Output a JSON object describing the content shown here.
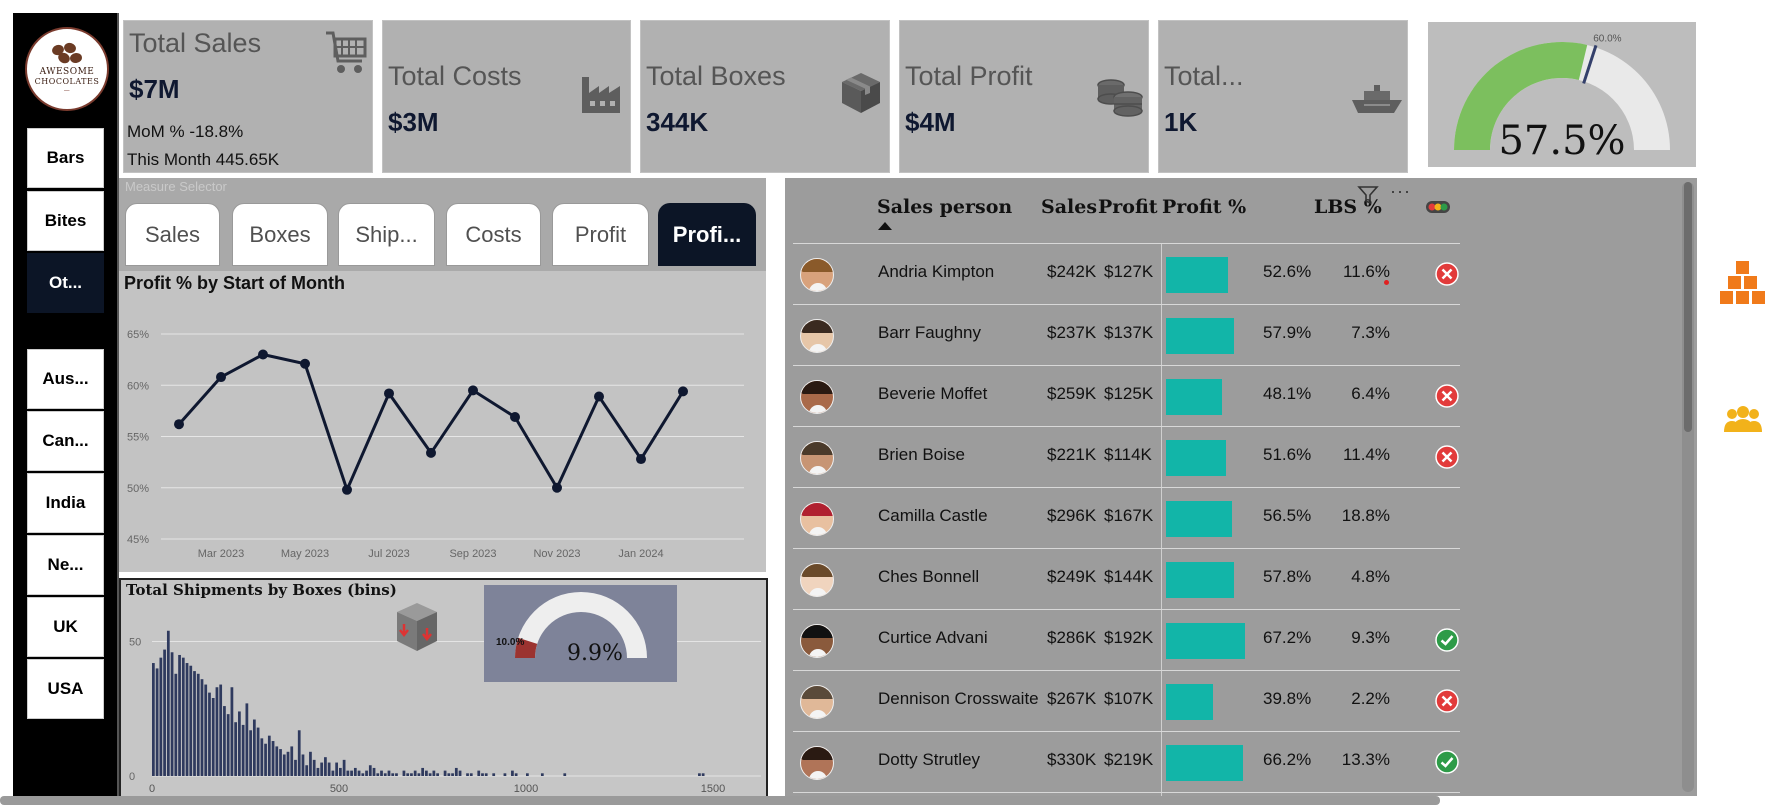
{
  "logo": {
    "line1": "AWESOME",
    "line2": "CHOCOLATES"
  },
  "slicer": {
    "categories": [
      "Bars",
      "Bites",
      "Ot..."
    ],
    "countries": [
      "Aus...",
      "Can...",
      "India",
      "Ne...",
      "UK",
      "USA"
    ]
  },
  "kpis": {
    "sales": {
      "title": "Total Sales",
      "value": "$7M",
      "mom": "MoM % -18.8%",
      "month": "This Month 445.65K",
      "icon": "shopping-cart-icon"
    },
    "costs": {
      "title": "Total Costs",
      "value": "$3M",
      "icon": "factory-icon"
    },
    "boxes": {
      "title": "Total Boxes",
      "value": "344K",
      "icon": "box-icon"
    },
    "profit": {
      "title": "Total Profit",
      "value": "$4M",
      "icon": "coins-icon"
    },
    "shipments": {
      "title": "Total...",
      "value": "1K",
      "icon": "ship-icon"
    }
  },
  "profit_gauge": {
    "value_label": "57.5%",
    "target_label": "60.0%",
    "value": 57.5,
    "target": 60,
    "colors": {
      "fill": "#7cbf5e",
      "track": "#e9e9e9",
      "target": "#34406b"
    }
  },
  "measure_selector": {
    "title": "Measure Selector",
    "options": [
      "Sales",
      "Boxes",
      "Ship...",
      "Costs",
      "Profit",
      "Profi..."
    ],
    "selected": "Profi..."
  },
  "line_chart": {
    "title": "Profit % by Start of Month",
    "y_ticks": [
      "65%",
      "60%",
      "55%",
      "50%",
      "45%"
    ],
    "x_ticks": [
      "Mar 2023",
      "May 2023",
      "Jul 2023",
      "Sep 2023",
      "Nov 2023",
      "Jan 2024"
    ]
  },
  "histogram": {
    "title": "Total Shipments by Boxes (bins)",
    "y_ticks": [
      "50",
      "0"
    ],
    "x_ticks": [
      "0",
      "500",
      "1000",
      "1500"
    ],
    "icon": "broken-box-icon"
  },
  "mini_gauge": {
    "value_label": "9.9%",
    "target_label": "10.0%",
    "value": 9.9,
    "target": 10,
    "colors": {
      "fill": "#9b3330",
      "track": "#eeeeee",
      "bg": "#7e8399"
    }
  },
  "table": {
    "headers": {
      "person": "Sales person",
      "sales": "Sales",
      "profit": "Profit",
      "profit_pct": "Profit %",
      "lbs_pct": "LBS %"
    },
    "rows": [
      {
        "name": "Andria Kimpton",
        "sales": "$242K",
        "profit": "$127K",
        "profit_pct": "52.6%",
        "pct_value": 52.6,
        "lbs": "11.6%",
        "status": "fail"
      },
      {
        "name": "Barr Faughny",
        "sales": "$237K",
        "profit": "$137K",
        "profit_pct": "57.9%",
        "pct_value": 57.9,
        "lbs": "7.3%",
        "status": "none"
      },
      {
        "name": "Beverie Moffet",
        "sales": "$259K",
        "profit": "$125K",
        "profit_pct": "48.1%",
        "pct_value": 48.1,
        "lbs": "6.4%",
        "status": "fail"
      },
      {
        "name": "Brien Boise",
        "sales": "$221K",
        "profit": "$114K",
        "profit_pct": "51.6%",
        "pct_value": 51.6,
        "lbs": "11.4%",
        "status": "fail"
      },
      {
        "name": "Camilla Castle",
        "sales": "$296K",
        "profit": "$167K",
        "profit_pct": "56.5%",
        "pct_value": 56.5,
        "lbs": "18.8%",
        "status": "none"
      },
      {
        "name": "Ches Bonnell",
        "sales": "$249K",
        "profit": "$144K",
        "profit_pct": "57.8%",
        "pct_value": 57.8,
        "lbs": "4.8%",
        "status": "none"
      },
      {
        "name": "Curtice Advani",
        "sales": "$286K",
        "profit": "$192K",
        "profit_pct": "67.2%",
        "pct_value": 67.2,
        "lbs": "9.3%",
        "status": "ok"
      },
      {
        "name": "Dennison Crosswaite",
        "sales": "$267K",
        "profit": "$107K",
        "profit_pct": "39.8%",
        "pct_value": 39.8,
        "lbs": "2.2%",
        "status": "fail"
      },
      {
        "name": "Dotty Strutley",
        "sales": "$330K",
        "profit": "$219K",
        "profit_pct": "66.2%",
        "pct_value": 66.2,
        "lbs": "13.3%",
        "status": "ok"
      }
    ]
  },
  "side_icons": [
    "boxes-stack-icon",
    "people-group-icon"
  ],
  "colors": {
    "accent_dark": "#0c1526",
    "teal_bar": "#12b5a8",
    "line": "#0f1830",
    "hist_bar": "#2f3a5e",
    "fail": "#e23b3b",
    "ok": "#2e9b48",
    "orange": "#f07a1a",
    "gold": "#f2b21a"
  },
  "chart_data": [
    {
      "type": "line",
      "title": "Profit % by Start of Month",
      "x": [
        "Feb 2023",
        "Mar 2023",
        "Apr 2023",
        "May 2023",
        "Jun 2023",
        "Jul 2023",
        "Aug 2023",
        "Sep 2023",
        "Oct 2023",
        "Nov 2023",
        "Dec 2023",
        "Jan 2024",
        "Feb 2024"
      ],
      "series": [
        {
          "values": [
            56.2,
            60.8,
            63.0,
            62.1,
            49.8,
            59.2,
            53.4,
            59.5,
            56.9,
            50.0,
            58.9,
            52.8,
            59.4
          ]
        }
      ],
      "ylim": [
        45,
        65
      ],
      "grid": true
    },
    {
      "type": "bar",
      "title": "Total Shipments by Boxes (bins)",
      "bin_width": 10,
      "x_start": 0,
      "values": [
        42,
        40,
        44,
        47,
        54,
        46,
        38,
        45,
        44,
        42,
        41,
        39,
        38,
        36,
        34,
        31,
        29,
        33,
        34,
        26,
        23,
        33,
        20,
        24,
        19,
        27,
        17,
        21,
        18,
        14,
        12,
        15,
        13,
        11,
        10,
        8,
        9,
        11,
        6,
        17,
        8,
        4,
        9,
        6,
        3,
        5,
        7,
        5,
        2,
        5,
        3,
        6,
        2,
        2,
        3,
        2,
        1,
        2,
        4,
        3,
        1,
        2,
        1,
        2,
        1,
        1,
        0,
        2,
        1,
        1,
        2,
        1,
        3,
        2,
        1,
        2,
        1,
        0,
        2,
        1,
        1,
        3,
        2,
        0,
        1,
        1,
        0,
        2,
        1,
        1,
        0,
        1,
        0,
        0,
        1,
        0,
        2,
        1,
        0,
        0,
        1,
        0,
        0,
        0,
        1,
        0,
        0,
        0,
        0,
        0,
        1,
        0,
        0,
        0,
        0,
        0,
        0,
        0,
        0,
        0,
        0,
        0,
        0,
        0,
        0,
        0,
        0,
        0,
        0,
        0,
        0,
        0,
        0,
        0,
        0,
        0,
        0,
        0,
        0,
        0,
        0,
        0,
        0,
        0,
        0,
        0,
        1,
        1
      ],
      "xlim": [
        0,
        1620
      ],
      "ylim": [
        0,
        58
      ],
      "grid": true
    }
  ]
}
